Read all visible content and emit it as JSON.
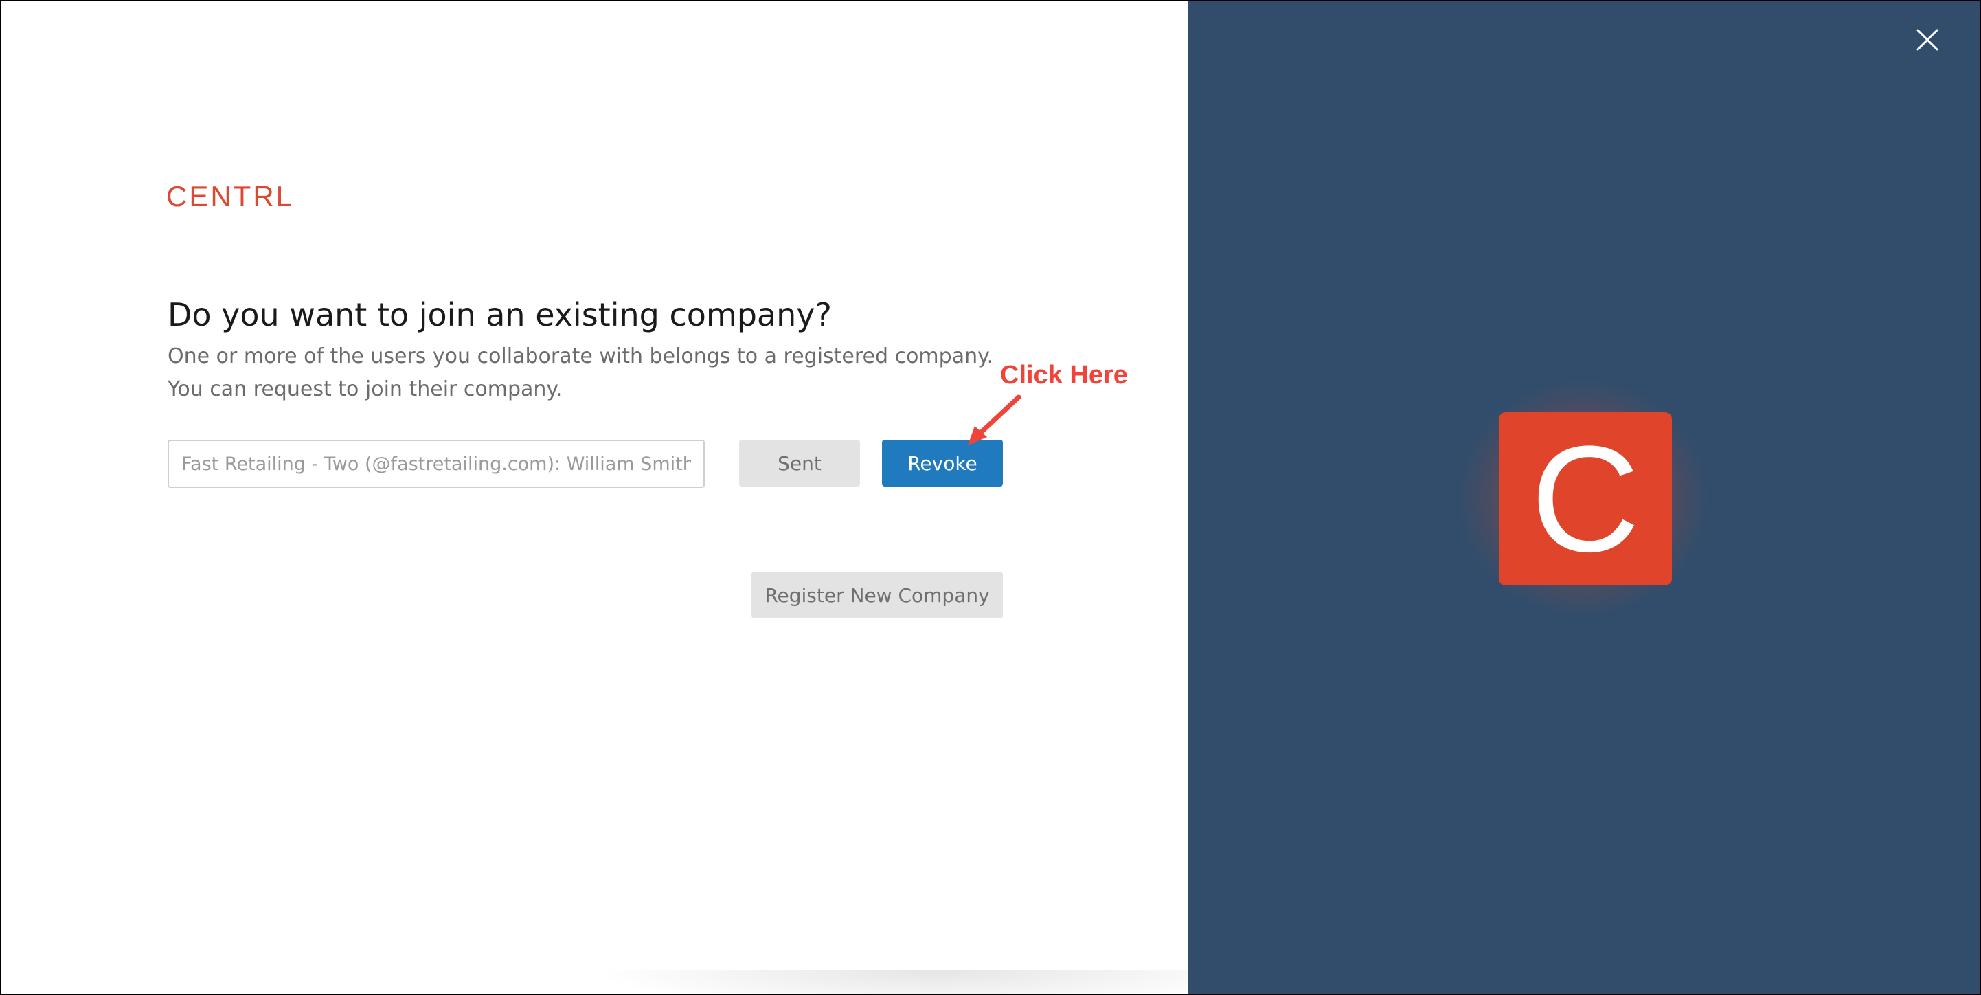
{
  "brand": {
    "logo_text": "CENTRL",
    "tile_letter": "C",
    "color": "#dc4830",
    "tile_color": "#e0452b"
  },
  "panel": {
    "background": "#314d6b",
    "close_icon": "close-icon"
  },
  "join": {
    "heading": "Do you want to join an existing company?",
    "description_line1": "One or more of the users you collaborate with belongs to a registered company.",
    "description_line2": "You can request to join their company.",
    "company_field_placeholder": "Fast Retailing - Two (@fastretailing.com): William Smith",
    "sent_label": "Sent",
    "revoke_label": "Revoke",
    "register_label": "Register New Company",
    "revoke_color": "#1f7bbd"
  },
  "annotation": {
    "text": "Click Here",
    "color": "#f0443a"
  }
}
